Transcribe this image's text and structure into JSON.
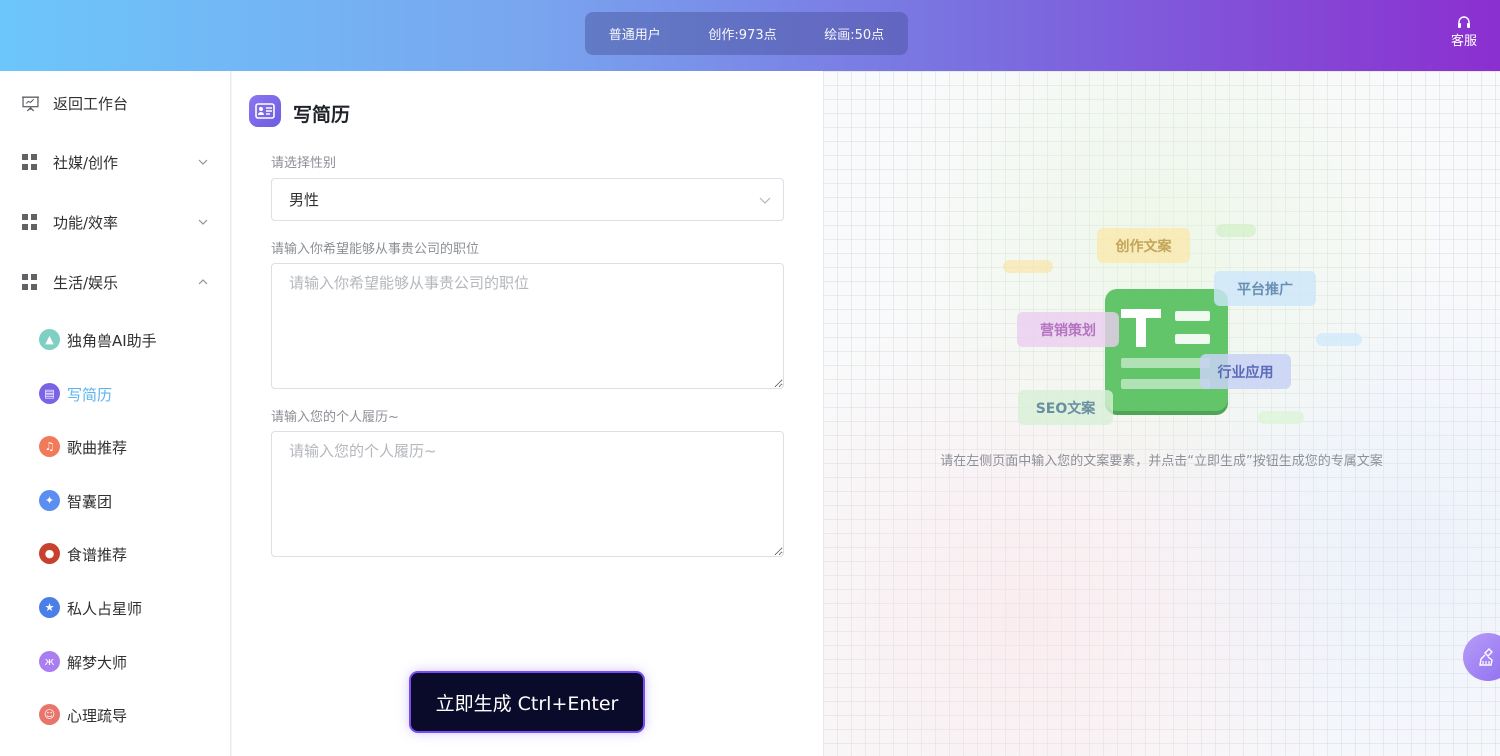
{
  "header": {
    "user_level": "普通用户",
    "creation_points": "创作:973点",
    "drawing_points": "绘画:50点",
    "service_label": "客服"
  },
  "sidebar": {
    "back_label": "返回工作台",
    "groups": [
      {
        "label": "社媒/创作",
        "expanded": false
      },
      {
        "label": "功能/效率",
        "expanded": false
      },
      {
        "label": "生活/娱乐",
        "expanded": true
      }
    ],
    "items": [
      {
        "label": "独角兽AI助手",
        "icon": "graduation-cap-icon",
        "color": "#7ecfc4"
      },
      {
        "label": "写简历",
        "icon": "resume-icon",
        "color": "#7b63e8",
        "active": true
      },
      {
        "label": "歌曲推荐",
        "icon": "music-note-icon",
        "color": "#f07a5a"
      },
      {
        "label": "智囊团",
        "icon": "lightbulb-icon",
        "color": "#5a8ef0"
      },
      {
        "label": "食谱推荐",
        "icon": "chef-hat-icon",
        "color": "#c8402e"
      },
      {
        "label": "私人占星师",
        "icon": "star-icon",
        "color": "#4a7fe8"
      },
      {
        "label": "解梦大师",
        "icon": "butterfly-icon",
        "color": "#a97ef0"
      },
      {
        "label": "心理疏导",
        "icon": "people-icon",
        "color": "#e8756c"
      }
    ]
  },
  "form": {
    "title": "写简历",
    "gender_label": "请选择性别",
    "gender_value": "男性",
    "position_label": "请输入你希望能够从事贵公司的职位",
    "position_placeholder": "请输入你希望能够从事贵公司的职位",
    "resume_label": "请输入您的个人履历~",
    "resume_placeholder": "请输入您的个人履历~",
    "submit_label": "立即生成 Ctrl+Enter"
  },
  "canvas": {
    "tags": [
      "创作文案",
      "平台推广",
      "营销策划",
      "行业应用",
      "SEO文案"
    ],
    "hint": "请在左侧页面中输入您的文案要素，并点击“立即生成”按钮生成您的专属文案"
  },
  "colors": {
    "accent": "#5ab3f0",
    "doc_green": "#63c56a",
    "submit_bg": "#0a0a2a"
  }
}
